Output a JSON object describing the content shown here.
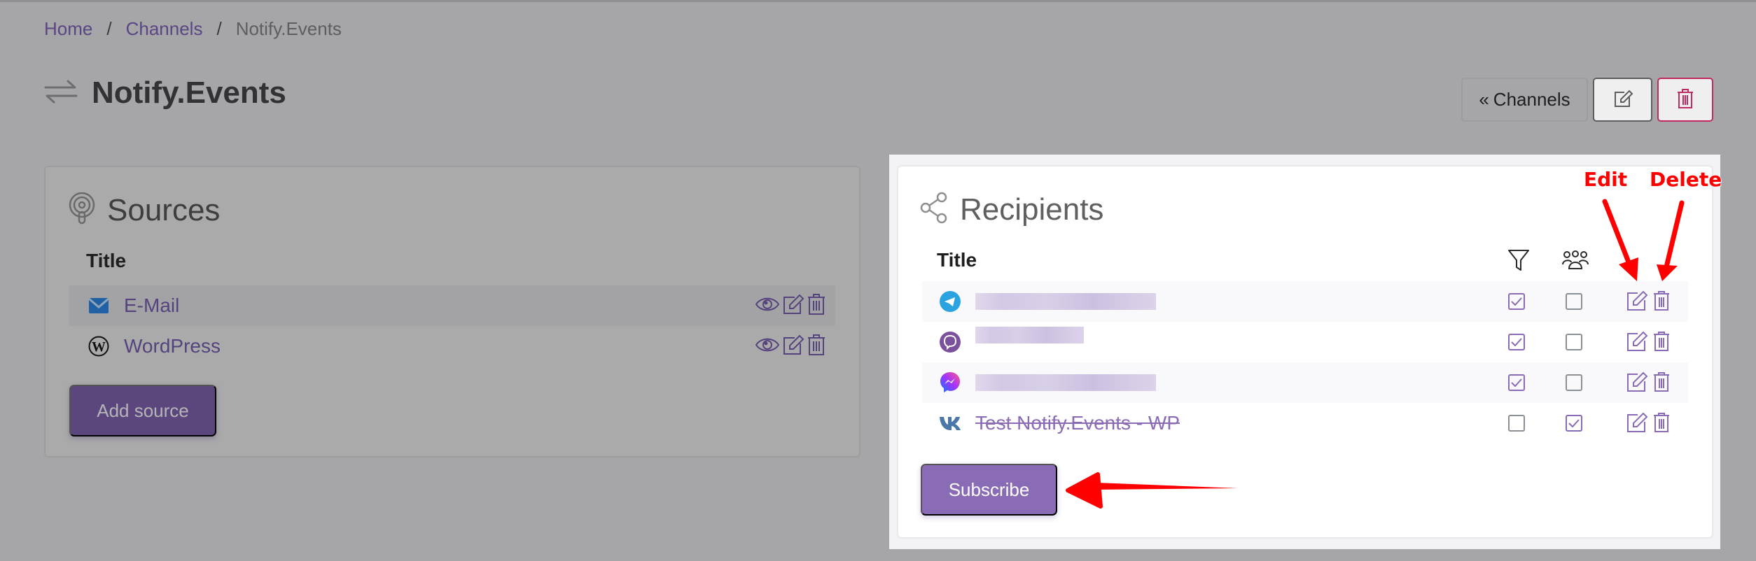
{
  "breadcrumb": {
    "items": [
      {
        "label": "Home"
      },
      {
        "label": "Channels"
      },
      {
        "label": "Notify.Events"
      }
    ],
    "separator": "/"
  },
  "header": {
    "title": "Notify.Events",
    "title_icon": "arrows-exchange-icon",
    "channels_button": "Channels",
    "channels_button_prefix": "«"
  },
  "sources": {
    "heading": "Sources",
    "heading_icon": "podcast-icon",
    "column_title": "Title",
    "items": [
      {
        "name": "E-Mail",
        "icon": "email-icon"
      },
      {
        "name": "WordPress",
        "icon": "wordpress-icon"
      }
    ],
    "add_button": "Add source"
  },
  "recipients": {
    "heading": "Recipients",
    "heading_icon": "share-icon",
    "column_title": "Title",
    "column_filter_icon": "filter-icon",
    "column_group_icon": "users-icon",
    "items": [
      {
        "service": "telegram",
        "name": "",
        "redacted": true,
        "filter": true,
        "group": false,
        "disabled": false
      },
      {
        "service": "viber",
        "name": "",
        "redacted": true,
        "filter": true,
        "group": false,
        "disabled": false
      },
      {
        "service": "messenger",
        "name": "",
        "redacted": true,
        "filter": true,
        "group": false,
        "disabled": false
      },
      {
        "service": "vk",
        "name": "Test Notify.Events - WP",
        "redacted": false,
        "filter": false,
        "group": true,
        "disabled": true
      }
    ],
    "subscribe_button": "Subscribe"
  },
  "annotations": {
    "edit_label": "Edit",
    "delete_label": "Delete"
  },
  "colors": {
    "brand_purple": "#8a6bb5",
    "danger": "#bf2a63",
    "annotation_red": "#ff0000"
  }
}
